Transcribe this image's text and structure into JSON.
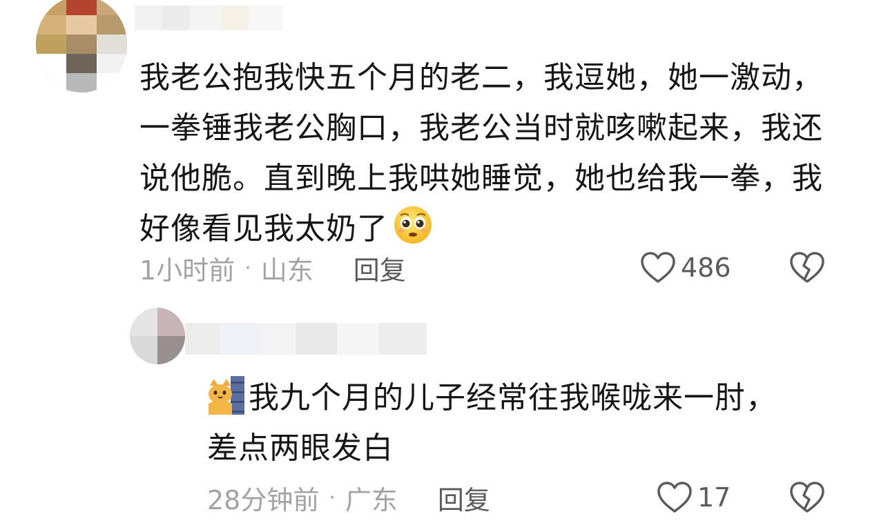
{
  "comments": [
    {
      "text": "我老公抱我快五个月的老二，我逗她，她一激动，一拳锤我老公胸口，我老公当时就咳嗽起来，我还说他脆。直到晚上我哄她睡觉，她也给我一拳，我好像看见我太奶了",
      "emoji": "pleading-face-emoji",
      "time": "1小时前",
      "separator": "·",
      "location": "山东",
      "reply_label": "回复",
      "like_count": "486"
    }
  ],
  "reply": {
    "emoji": "cat-peeking-emoji",
    "text": "我九个月的儿子经常往我喉咙来一肘，差点两眼发白",
    "time": "28分钟前",
    "separator": "·",
    "location": "广东",
    "reply_label": "回复",
    "like_count": "17"
  },
  "colors": {
    "text": "#161616",
    "meta": "#a3a3a3",
    "action": "#5a5a5a",
    "background": "#ffffff"
  }
}
